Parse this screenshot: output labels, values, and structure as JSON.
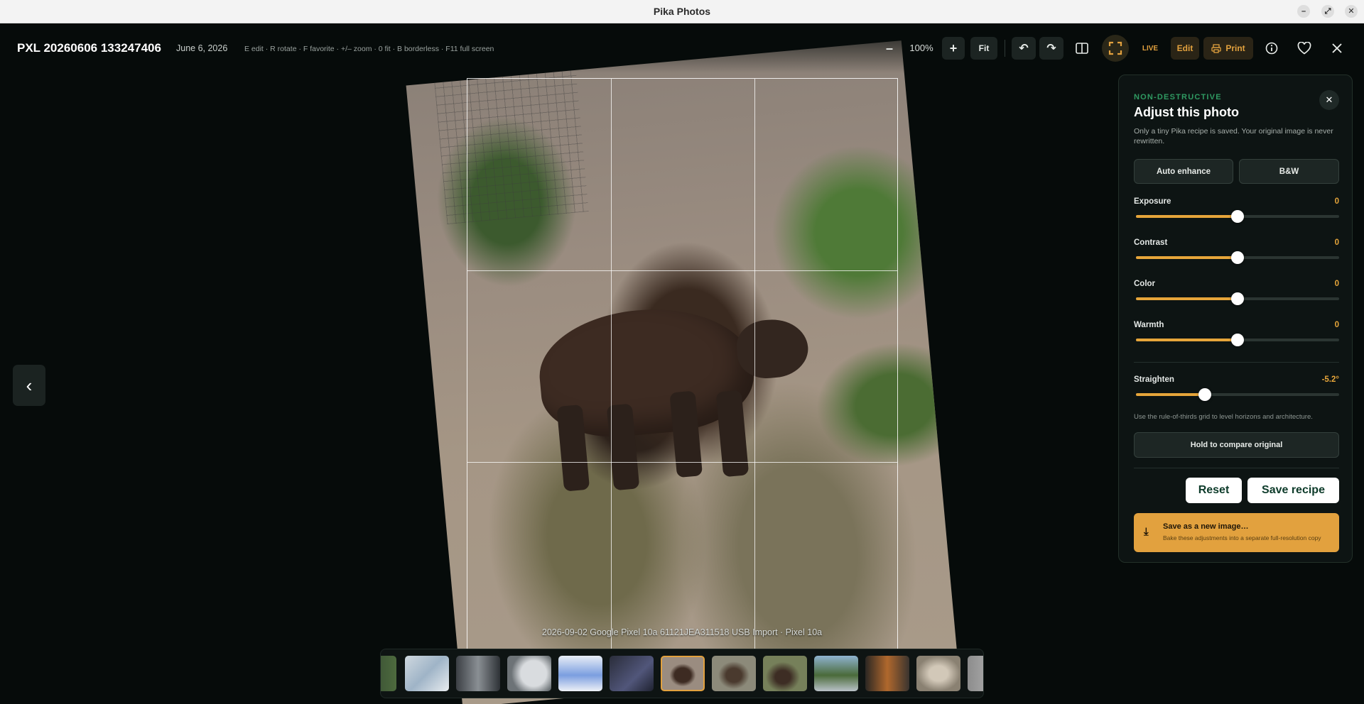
{
  "window": {
    "title": "Pika Photos",
    "controls": [
      "–",
      "⤢",
      "✕"
    ]
  },
  "viewer": {
    "filename": "PXL 20260606 133247406",
    "date": "June 6, 2026",
    "shortcuts": "E edit · R rotate · F favorite · +/– zoom · 0 fit · B borderless · F11 full screen",
    "zoom_out_label": "–",
    "zoom_level": "100%",
    "zoom_in_label": "+",
    "fit_label": "Fit",
    "undo_icon": "↶",
    "redo_icon": "↷",
    "live_label": "LIVE",
    "edit_label": "Edit",
    "print_label": "Print",
    "caption": "2026-09-02 Google Pixel 10a 61121JEA311518 USB Import · Pixel 10a",
    "prev_icon": "‹",
    "icons": [
      "columns-icon",
      "fullscreen-icon",
      "info-icon",
      "heart-icon",
      "close-icon",
      "printer-icon"
    ]
  },
  "panel": {
    "eyebrow": "NON-DESTRUCTIVE",
    "title": "Adjust this photo",
    "description": "Only a tiny Pika recipe is saved. Your original image is never rewritten.",
    "close_icon": "✕",
    "auto_enhance": "Auto enhance",
    "bw": "B&W",
    "sliders": [
      {
        "label": "Exposure",
        "value": "0",
        "fraction": 0.5
      },
      {
        "label": "Contrast",
        "value": "0",
        "fraction": 0.5
      },
      {
        "label": "Color",
        "value": "0",
        "fraction": 0.5
      },
      {
        "label": "Warmth",
        "value": "0",
        "fraction": 0.5
      }
    ],
    "straighten": {
      "label": "Straighten",
      "value": "-5.2°",
      "fraction": 0.34
    },
    "hint": "Use the rule-of-thirds grid to level horizons and architecture.",
    "compare": "Hold to compare original",
    "reset": "Reset",
    "save_recipe": "Save recipe",
    "save_image_title": "Save as a new image…",
    "save_image_sub": "Bake these adjustments into a separate full-resolution copy",
    "download_icon": "⤓"
  },
  "colors": {
    "accent": "#e2a13e",
    "eyebrow": "#2f9a62",
    "background": "#060b0a"
  }
}
